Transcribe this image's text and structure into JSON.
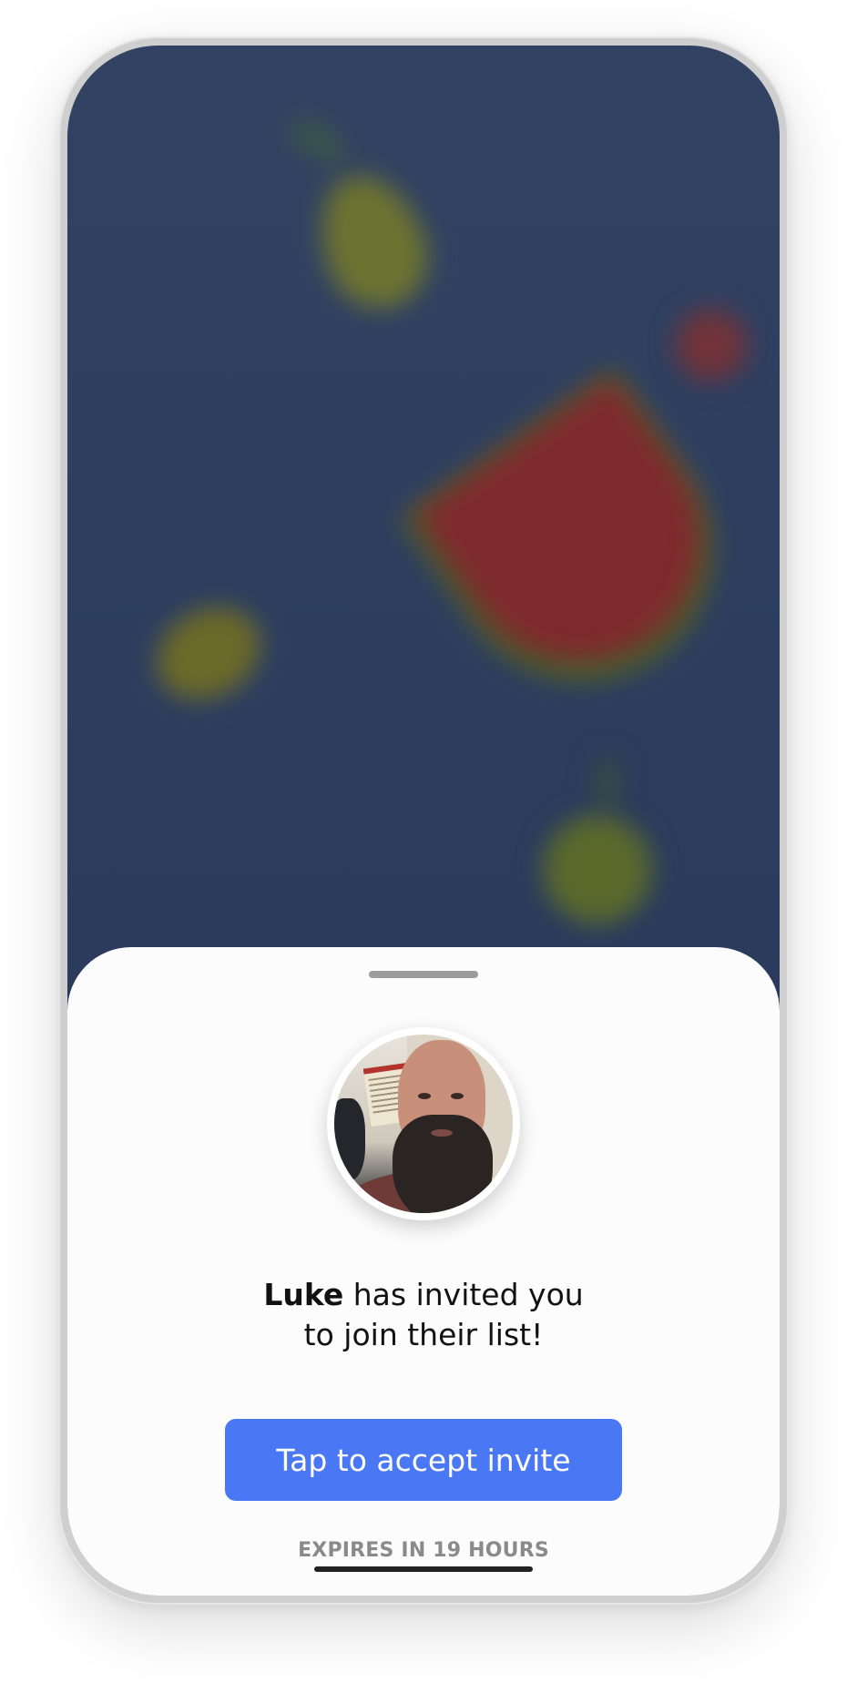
{
  "invite": {
    "inviter_name": "Luke",
    "message_part1": " has invited you",
    "message_part2": "to join their list!"
  },
  "accept_button": {
    "label": "Tap to accept invite"
  },
  "expiry": {
    "text": "EXPIRES IN 19 HOURS"
  },
  "colors": {
    "accent": "#4a78f5",
    "background_dark": "#2c3d5f",
    "sheet": "#fcfcfc"
  },
  "icons": {
    "avatar": "user-avatar-photo"
  }
}
